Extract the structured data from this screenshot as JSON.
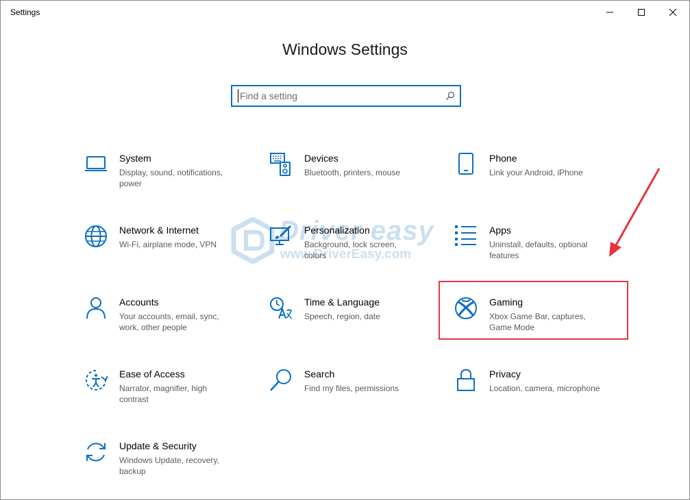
{
  "window": {
    "title": "Settings"
  },
  "titlebar": {
    "controls": [
      {
        "name": "minimize-icon"
      },
      {
        "name": "maximize-icon"
      },
      {
        "name": "close-icon"
      }
    ]
  },
  "page": {
    "title": "Windows Settings"
  },
  "search": {
    "placeholder": "Find a setting",
    "value": "",
    "icon": "search-icon"
  },
  "tiles": [
    {
      "label": "System",
      "description": "Display, sound, notifications, power",
      "icon": "laptop-icon"
    },
    {
      "label": "Devices",
      "description": "Bluetooth, printers, mouse",
      "icon": "devices-icon"
    },
    {
      "label": "Phone",
      "description": "Link your Android, iPhone",
      "icon": "phone-icon"
    },
    {
      "label": "Network & Internet",
      "description": "Wi-Fi, airplane mode, VPN",
      "icon": "globe-icon"
    },
    {
      "label": "Personalization",
      "description": "Background, lock screen, colors",
      "icon": "paint-icon"
    },
    {
      "label": "Apps",
      "description": "Uninstall, defaults, optional features",
      "icon": "apps-list-icon"
    },
    {
      "label": "Accounts",
      "description": "Your accounts, email, sync, work, other people",
      "icon": "person-icon"
    },
    {
      "label": "Time & Language",
      "description": "Speech, region, date",
      "icon": "time-language-icon"
    },
    {
      "label": "Gaming",
      "description": "Xbox Game Bar, captures, Game Mode",
      "icon": "xbox-icon"
    },
    {
      "label": "Ease of Access",
      "description": "Narrator, magnifier, high contrast",
      "icon": "ease-of-access-icon"
    },
    {
      "label": "Search",
      "description": "Find my files, permissions",
      "icon": "magnifier-icon"
    },
    {
      "label": "Privacy",
      "description": "Location, camera, microphone",
      "icon": "lock-icon"
    },
    {
      "label": "Update & Security",
      "description": "Windows Update, recovery, backup",
      "icon": "sync-icon"
    }
  ],
  "annotation": {
    "highlighted_tile": "Gaming",
    "highlight_color": "#e4363c",
    "arrow_color": "#e4363c"
  },
  "watermark": {
    "brand": "Driver easy",
    "url": "www.DriverEasy.com"
  },
  "colors": {
    "accent": "#0a6ec1",
    "text": "#000000",
    "secondary_text": "#5a5a5a"
  }
}
